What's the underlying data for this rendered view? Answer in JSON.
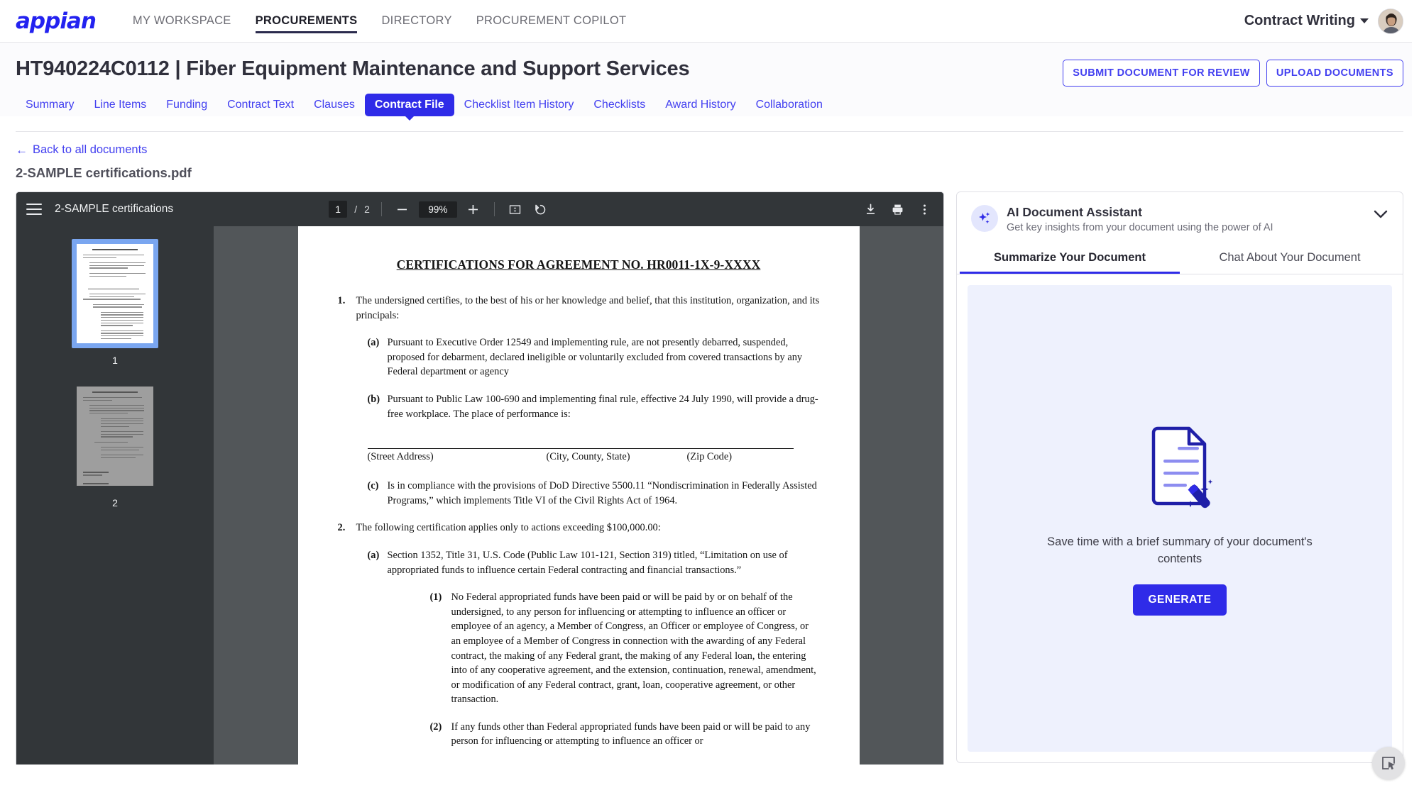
{
  "topnav": {
    "logo": "appian",
    "items": [
      {
        "label": "MY WORKSPACE",
        "active": false
      },
      {
        "label": "PROCUREMENTS",
        "active": true
      },
      {
        "label": "DIRECTORY",
        "active": false
      },
      {
        "label": "PROCUREMENT COPILOT",
        "active": false
      }
    ],
    "user_name": "Contract Writing",
    "avatar_icon": "user-avatar-photo",
    "caret_icon": "chevron-down-icon"
  },
  "header": {
    "title": "HT940224C0112 | Fiber Equipment Maintenance and Support Services",
    "actions": [
      {
        "label": "SUBMIT DOCUMENT FOR REVIEW"
      },
      {
        "label": "UPLOAD DOCUMENTS"
      }
    ]
  },
  "tabs": [
    {
      "label": "Summary",
      "active": false
    },
    {
      "label": "Line Items",
      "active": false
    },
    {
      "label": "Funding",
      "active": false
    },
    {
      "label": "Contract Text",
      "active": false
    },
    {
      "label": "Clauses",
      "active": false
    },
    {
      "label": "Contract File",
      "active": true
    },
    {
      "label": "Checklist Item History",
      "active": false
    },
    {
      "label": "Checklists",
      "active": false
    },
    {
      "label": "Award History",
      "active": false
    },
    {
      "label": "Collaboration",
      "active": false
    }
  ],
  "document_header": {
    "back_link": "Back to all documents",
    "back_arrow_icon": "arrow-left-icon",
    "file_name": "2-SAMPLE certifications.pdf"
  },
  "pdf_viewer": {
    "menu_icon": "hamburger-menu-icon",
    "title": "2-SAMPLE certifications",
    "current_page": "1",
    "page_separator": "/",
    "total_pages": "2",
    "zoom_out_icon": "minus-icon",
    "zoom_level": "99%",
    "zoom_in_icon": "plus-icon",
    "fit_page_icon": "fit-to-page-icon",
    "rotate_icon": "rotate-counterclockwise-icon",
    "download_icon": "download-icon",
    "print_icon": "print-icon",
    "more_icon": "more-vertical-icon",
    "thumbnails": [
      {
        "number": "1",
        "selected": true
      },
      {
        "number": "2",
        "selected": false
      }
    ]
  },
  "pdf_page": {
    "heading": "CERTIFICATIONS FOR AGREEMENT NO. HR0011-1X-9-XXXX",
    "items": [
      {
        "marker": "1.",
        "level": 1,
        "text": "The undersigned certifies, to the best of his or her knowledge and belief, that this institution, organization, and its principals:"
      },
      {
        "marker": "(a)",
        "level": 2,
        "text": "Pursuant to Executive Order 12549 and implementing rule, are not presently debarred, suspended, proposed for debarment, declared ineligible or voluntarily excluded from covered transactions by any Federal department or agency"
      },
      {
        "marker": "(b)",
        "level": 2,
        "text": "Pursuant to Public Law 100-690 and implementing final rule, effective 24 July 1990, will provide a drug-free workplace. The place of performance is:"
      }
    ],
    "address_labels": [
      "(Street Address)",
      "(City, County, State)",
      "(Zip Code)"
    ],
    "items_after": [
      {
        "marker": "(c)",
        "level": 2,
        "text": "Is in compliance with the provisions of DoD Directive 5500.11 “Nondiscrimination in Federally Assisted Programs,” which implements Title VI of the Civil Rights Act of 1964."
      },
      {
        "marker": "2.",
        "level": 1,
        "text": "The following certification applies only to actions exceeding $100,000.00:"
      },
      {
        "marker": "(a)",
        "level": 2,
        "text": "Section 1352, Title 31, U.S. Code (Public Law 101-121, Section 319) titled, “Limitation on use of appropriated funds to influence certain Federal contracting and financial transactions.”"
      },
      {
        "marker": "(1)",
        "level": 3,
        "text": "No Federal appropriated funds have been paid or will be paid by or on behalf of the undersigned, to any person for influencing or attempting to influence an officer or employee of an agency, a Member of Congress, an Officer or employee of Congress, or an employee of a Member of Congress in connection with the awarding of any Federal contract, the making of any Federal grant, the making of any Federal loan, the entering into of any cooperative agreement, and the extension, continuation, renewal, amendment, or modification of any Federal contract, grant, loan, cooperative agreement, or other transaction."
      },
      {
        "marker": "(2)",
        "level": 3,
        "text": "If any funds other than Federal appropriated funds have been paid or will be paid to any person for influencing or attempting to influence an officer or"
      }
    ]
  },
  "ai_panel": {
    "sparkle_icon": "sparkle-ai-icon",
    "title": "AI Document Assistant",
    "subtitle": "Get key insights from your document using the power of AI",
    "collapse_icon": "chevron-down-icon",
    "tabs": [
      {
        "label": "Summarize Your Document",
        "active": true
      },
      {
        "label": "Chat About Your Document",
        "active": false
      }
    ],
    "illustration_icon": "document-magic-wand-icon",
    "empty_message": "Save time with a brief summary of your document's contents",
    "generate_label": "GENERATE"
  },
  "corner_button": {
    "icon": "select-region-cursor-icon"
  },
  "colors": {
    "brand_blue": "#2f2be8",
    "link_blue": "#4340f0",
    "nav_active": "#2b2b4d",
    "pdf_chrome": "#323639",
    "pdf_backdrop": "#525659",
    "ai_card_bg": "#eef1fd"
  }
}
